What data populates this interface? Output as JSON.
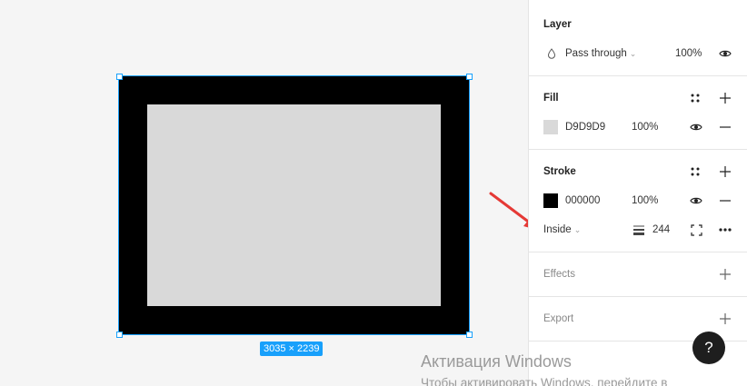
{
  "canvas": {
    "frame_dimensions": "3035 × 2239",
    "frame_color": "#000000",
    "inner_fill_color": "#D9D9D9",
    "selection_color": "#18A0FB",
    "annotation_arrow_color": "#E53935"
  },
  "panel": {
    "layer": {
      "title": "Layer",
      "blend_icon": "drop-icon",
      "blend_mode": "Pass through",
      "opacity": "100%",
      "visibility_icon": "eye-icon"
    },
    "fill": {
      "title": "Fill",
      "styles_icon": "four-dots-icon",
      "add_icon": "plus-icon",
      "color_hex": "D9D9D9",
      "swatch_color": "#D9D9D9",
      "opacity": "100%",
      "visibility_icon": "eye-icon",
      "remove_icon": "minus-icon"
    },
    "stroke": {
      "title": "Stroke",
      "styles_icon": "four-dots-icon",
      "add_icon": "plus-icon",
      "color_hex": "000000",
      "swatch_color": "#000000",
      "opacity": "100%",
      "visibility_icon": "eye-icon",
      "remove_icon": "minus-icon",
      "position": "Inside",
      "weight_icon": "stroke-weight-icon",
      "weight": "244",
      "sides_icon": "stroke-sides-icon",
      "more_icon": "more-icon"
    },
    "effects": {
      "title": "Effects",
      "add_icon": "plus-icon"
    },
    "export": {
      "title": "Export",
      "add_icon": "plus-icon"
    }
  },
  "help": {
    "label": "?"
  },
  "watermark": {
    "title": "Активация Windows",
    "subtitle": "Чтобы активировать Windows, перейдите в"
  }
}
